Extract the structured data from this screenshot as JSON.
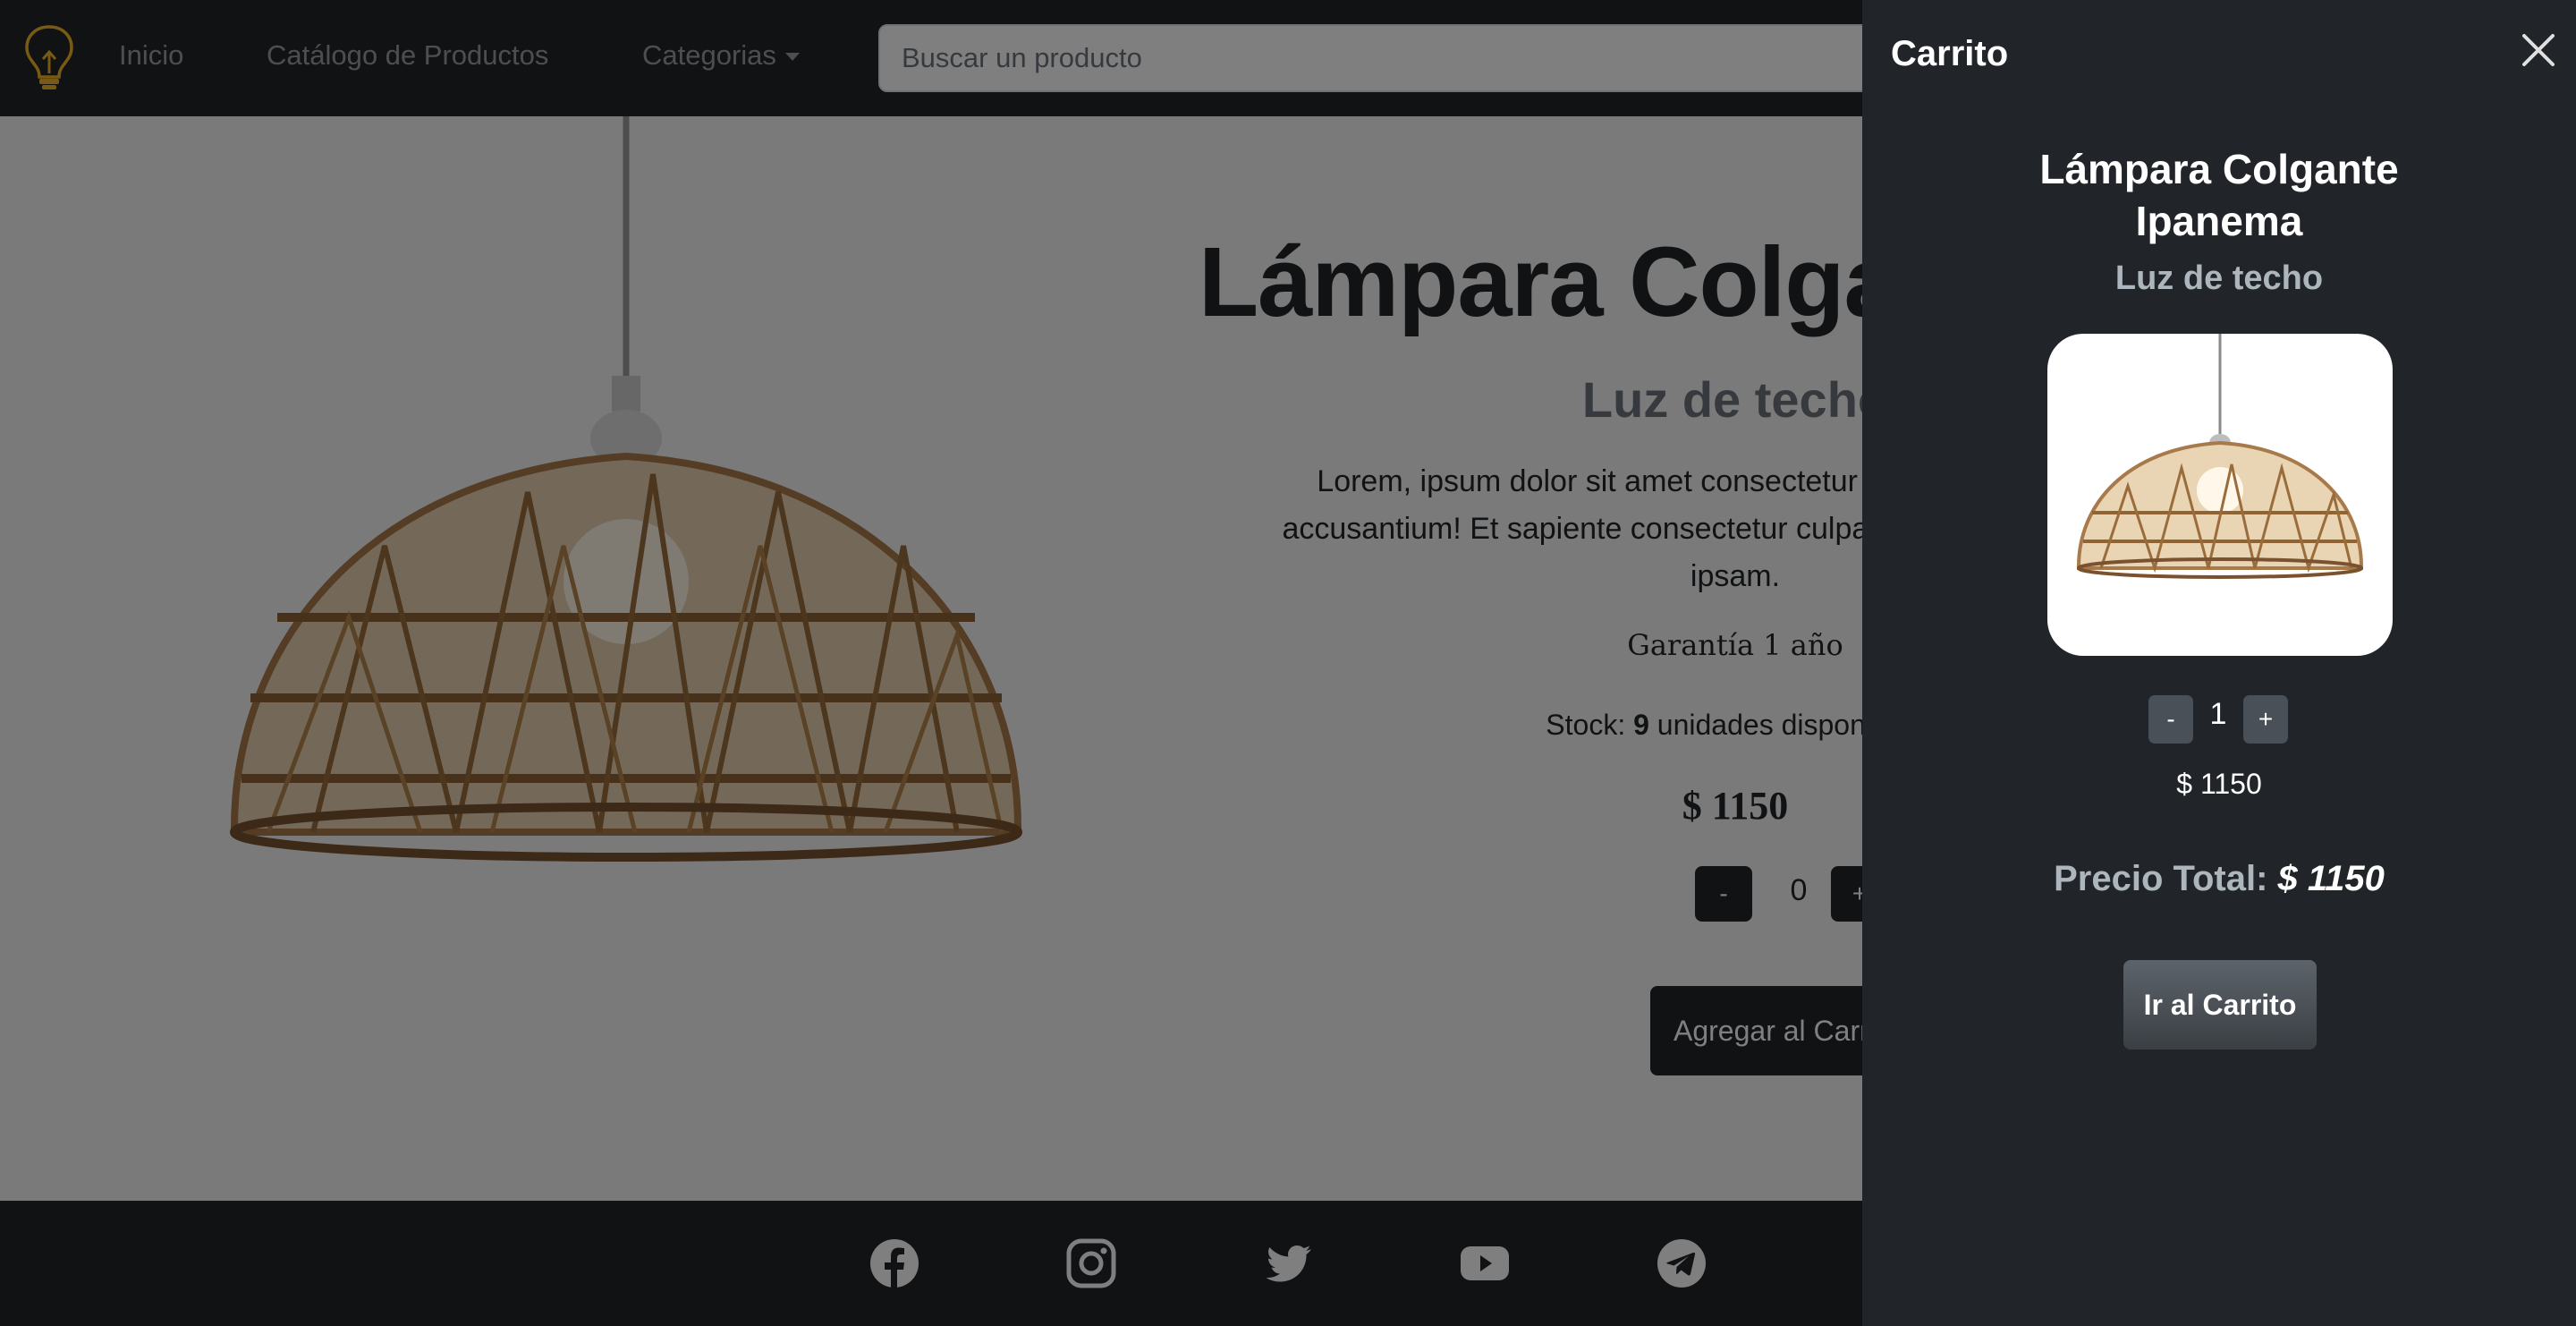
{
  "navbar": {
    "links": [
      "Inicio",
      "Catálogo de Productos",
      "Categorias"
    ],
    "search_placeholder": "Buscar un producto"
  },
  "product": {
    "title": "Lámpara Colgante Ipanema",
    "category": "Luz de techo",
    "description": "Lorem, ipsum dolor sit amet consectetur adipisicing elit. Quas, accusantium! Et sapiente consectetur culpa quibusdam, in voluptas ipsam.",
    "warranty": "Garantía 1 año",
    "stock_label": "Stock:",
    "stock_value": "9",
    "stock_suffix": "unidades disponibles",
    "price": "$ 1150",
    "qty_minus": "-",
    "qty_value": "0",
    "qty_plus": "+",
    "add_to_cart": "Agregar al Carrito"
  },
  "footer": {
    "social_icons": [
      "facebook-icon",
      "instagram-icon",
      "twitter-icon",
      "youtube-icon",
      "telegram-icon"
    ]
  },
  "cart": {
    "title": "Carrito",
    "item": {
      "name": "Lámpara Colgante Ipanema",
      "category": "Luz de techo",
      "qty_minus": "-",
      "qty_value": "1",
      "qty_plus": "+",
      "price": "$ 1150"
    },
    "total_label": "Precio Total:",
    "total_value": "$ 1150",
    "go_to_cart": "Ir al Carrito"
  },
  "colors": {
    "navbar_bg": "#212529",
    "drawer_bg": "#212529",
    "logo": "#f0b429"
  }
}
